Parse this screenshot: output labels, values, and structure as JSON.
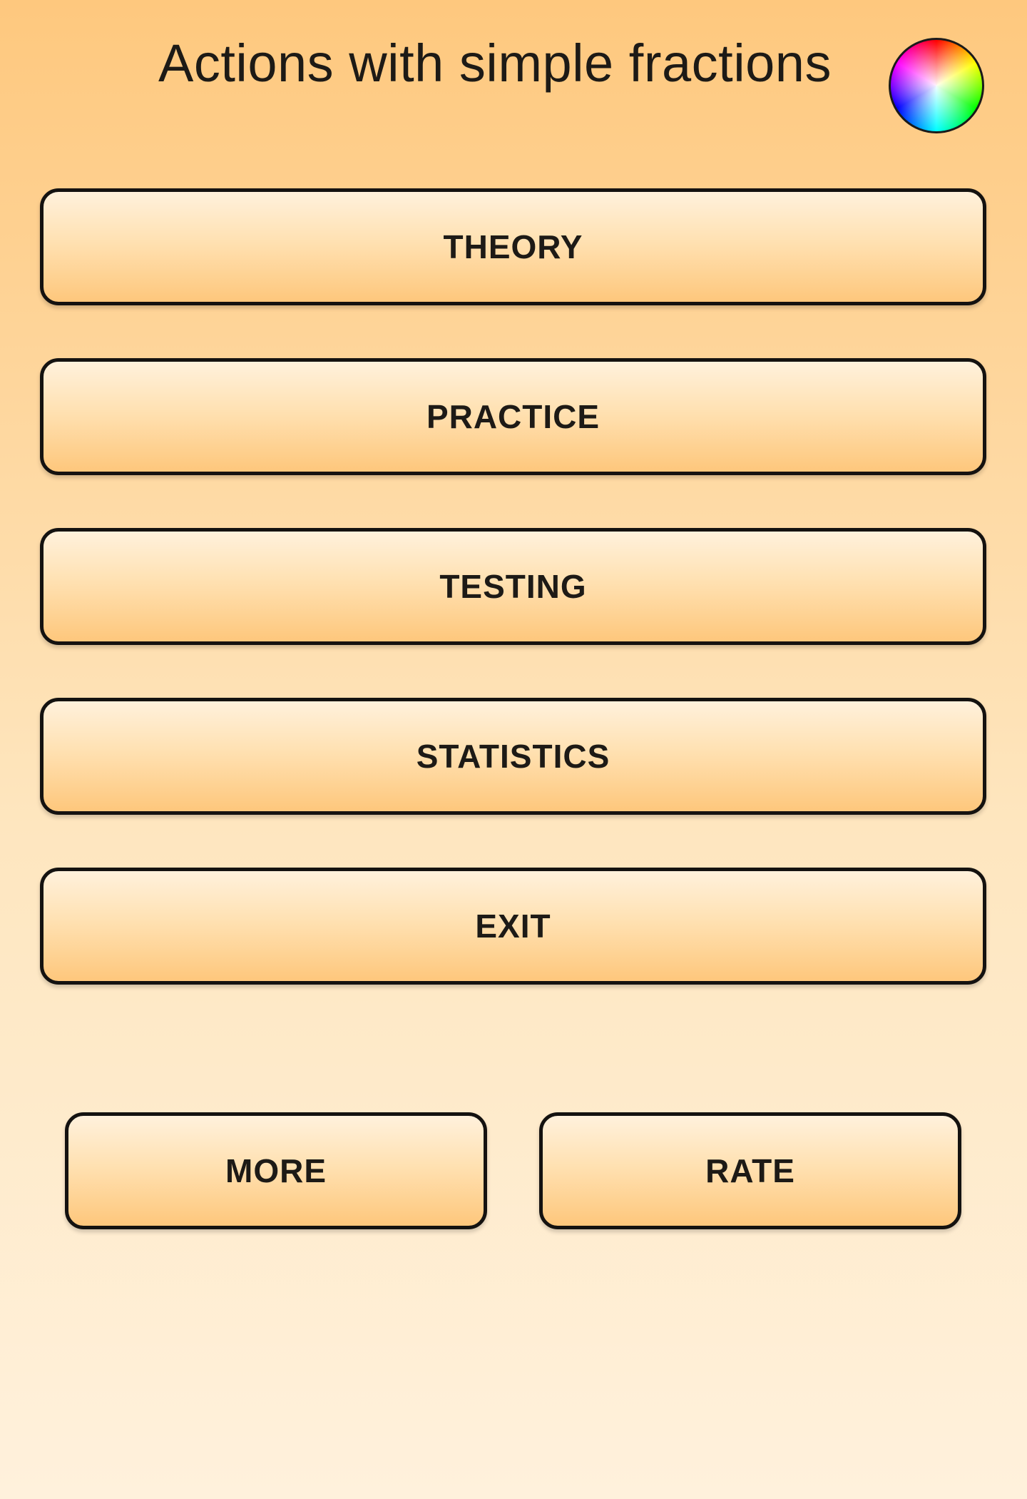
{
  "header": {
    "title": "Actions with simple fractions",
    "theme_icon": "color-wheel-icon"
  },
  "menu": {
    "theory": "THEORY",
    "practice": "PRACTICE",
    "testing": "TESTING",
    "statistics": "STATISTICS",
    "exit": "EXIT"
  },
  "footer": {
    "more": "MORE",
    "rate": "RATE"
  },
  "colors": {
    "background_top": "#fec87e",
    "background_bottom": "#fff1dc",
    "button_border": "#141210",
    "text": "#1d1a16"
  }
}
